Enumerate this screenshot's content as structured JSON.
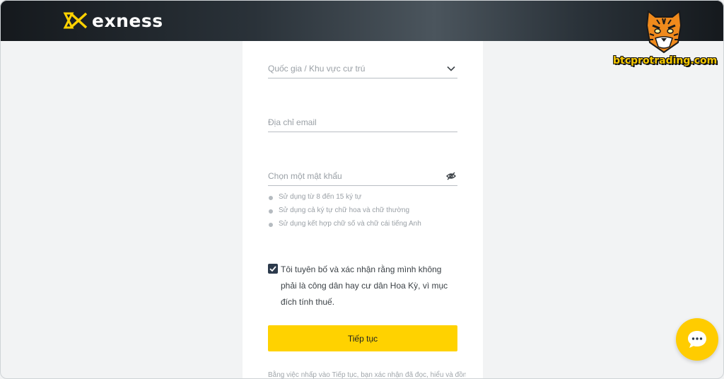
{
  "brand": {
    "logo_text": "exness",
    "logo_icon": "exness-logo-icon",
    "accent": "#ffd200"
  },
  "watermark": {
    "text": "btcprotrading.com",
    "icon": "tiger-icon"
  },
  "form": {
    "country_placeholder": "Quốc gia / Khu vực cư trú",
    "country_icon": "chevron-down-icon",
    "email_placeholder": "Địa chỉ email",
    "password_placeholder": "Chọn một mật khẩu",
    "password_icon": "eye-hidden-icon",
    "password_rules": [
      "Sử dụng từ 8 đến 15 ký tự",
      "Sử dụng cả ký tự chữ hoa và chữ thường",
      "Sử dụng kết hợp chữ số và chữ cái tiếng Anh"
    ],
    "consent_checked": true,
    "consent_text": "Tôi tuyên bố và xác nhận rằng mình không phải là công dân hay cư dân Hoa Kỳ, vì mục đích tính thuế.",
    "continue_label": "Tiếp tục",
    "terms_text": "Bằng việc nhấp vào Tiếp tục, bạn xác nhận đã đọc, hiểu và đồng ý"
  },
  "chat": {
    "icon": "chat-bubble-icon"
  }
}
